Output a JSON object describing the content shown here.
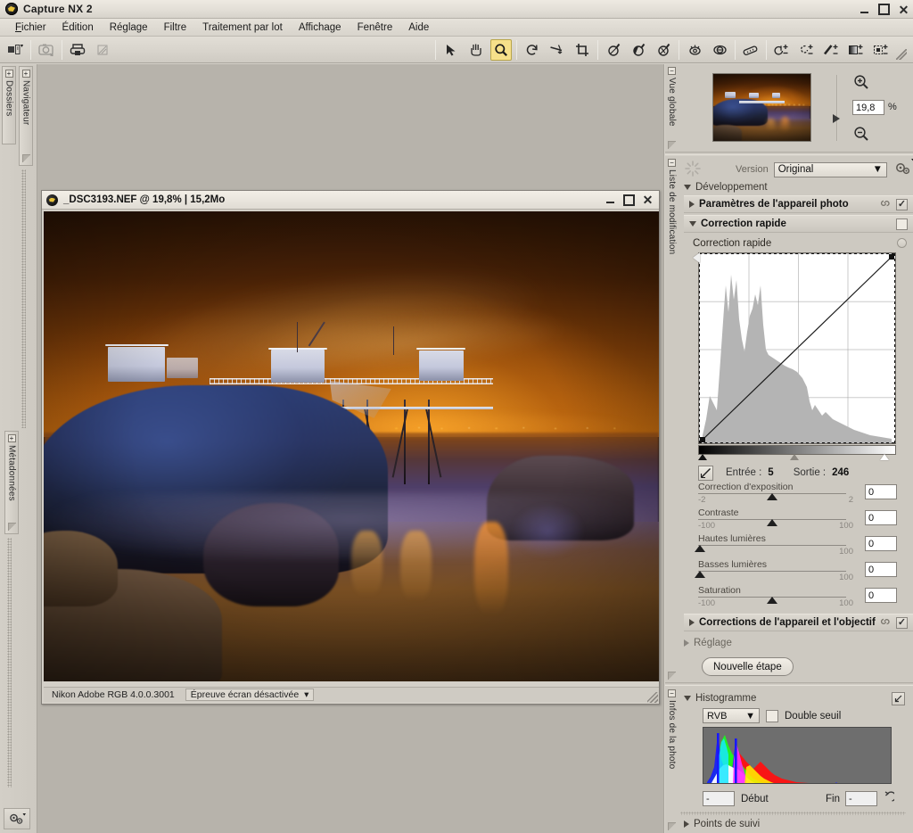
{
  "app": {
    "title": "Capture NX 2",
    "logo_icon": "nikon-nx-logo",
    "window_controls": {
      "minimize": "minimize-icon",
      "maximize": "maximize-icon",
      "close": "close-icon"
    }
  },
  "menubar": {
    "items": [
      {
        "label": "Fichier",
        "accel": "F"
      },
      {
        "label": "Édition",
        "accel": "É"
      },
      {
        "label": "Réglage",
        "accel": "g"
      },
      {
        "label": "Filtre",
        "accel": "t"
      },
      {
        "label": "Traitement par lot",
        "accel": "p"
      },
      {
        "label": "Affichage",
        "accel": "A"
      },
      {
        "label": "Fenêtre",
        "accel": "e"
      },
      {
        "label": "Aide",
        "accel": "i"
      }
    ]
  },
  "toolbar": {
    "left_group": [
      {
        "name": "open-image-browser-icon",
        "enabled": true
      },
      {
        "name": "camera-transfer-icon",
        "enabled": false
      },
      {
        "name": "print-icon",
        "enabled": true
      },
      {
        "name": "print-options-icon",
        "enabled": false
      }
    ],
    "right_group": [
      {
        "name": "direct-select-arrow-icon",
        "active": false
      },
      {
        "name": "hand-pan-icon",
        "active": false
      },
      {
        "name": "zoom-magnifier-icon",
        "active": true
      },
      {
        "name": "rotate-icon",
        "active": false
      },
      {
        "name": "straighten-icon",
        "active": false
      },
      {
        "name": "crop-icon",
        "active": false
      },
      {
        "name": "white-balance-eyedropper-icon",
        "active": false
      },
      {
        "name": "black-control-point-icon",
        "active": false
      },
      {
        "name": "color-control-point-icon",
        "active": false
      },
      {
        "name": "red-eye-icon",
        "active": false
      },
      {
        "name": "auto-retouch-brush-icon",
        "active": false
      },
      {
        "name": "measure-ruler-icon",
        "active": false
      },
      {
        "name": "selection-brush-icon",
        "active": false
      },
      {
        "name": "lasso-selection-icon",
        "active": false
      },
      {
        "name": "selection-pencil-icon",
        "active": false
      },
      {
        "name": "gradient-selection-icon",
        "active": false
      },
      {
        "name": "fill-remove-selection-icon",
        "active": false
      }
    ]
  },
  "left_dock": {
    "tabs": [
      {
        "label": "Dossiers",
        "name": "sidebar-tab-dossiers"
      },
      {
        "label": "Navigateur",
        "name": "sidebar-tab-navigateur"
      },
      {
        "label": "Métadonnées",
        "name": "sidebar-tab-metadonnees"
      }
    ],
    "settings_icon": "gears-icon"
  },
  "document_window": {
    "logo_icon": "nikon-nx-logo",
    "title": "_DSC3193.NEF @ 19,8% | 15,2Mo",
    "controls": {
      "minimize": "minimize-icon",
      "maximize": "maximize-icon",
      "close": "close-icon"
    },
    "status": {
      "color_profile": "Nikon Adobe RGB 4.0.0.3001",
      "soft_proof": "Épreuve écran désactivée"
    },
    "photo_alt": "Night coastal scene with illuminated fishing huts on stilts, blue-lit rocks and orange city lights on the horizon"
  },
  "right_dock": {
    "overview": {
      "tab_label": "Vue globale",
      "zoom_in_icon": "zoom-in-icon",
      "zoom_out_icon": "zoom-out-icon",
      "zoom_value": "19,8",
      "zoom_unit": "%"
    },
    "edit_list": {
      "tab_label": "Liste de modification",
      "sun_icon": "sun-burst-icon",
      "version_label": "Version",
      "version_value": "Original",
      "settings_icon": "gears-icon",
      "group_title": "Développement",
      "steps": [
        {
          "label": "Paramètres de l'appareil photo",
          "expanded": false,
          "link_icon": "chain-link-icon",
          "checked": true
        },
        {
          "label": "Correction rapide",
          "expanded": true,
          "checked": false
        }
      ],
      "quick_fix": {
        "sub_label": "Correction rapide",
        "reset_icon": "reset-circle-icon",
        "input_label": "Entrée :",
        "input_value": "5",
        "output_label": "Sortie :",
        "output_value": "246",
        "curve_icon": "curve-diagonal-icon",
        "sliders": [
          {
            "label": "Correction d'exposition",
            "min": "-2",
            "max": "2",
            "value": "0",
            "thumb_pct": 50
          },
          {
            "label": "Contraste",
            "min": "-100",
            "max": "100",
            "value": "0",
            "thumb_pct": 50
          },
          {
            "label": "Hautes lumières",
            "min": "",
            "max": "100",
            "value": "0",
            "thumb_pct": 3
          },
          {
            "label": "Basses lumières",
            "min": "",
            "max": "100",
            "value": "0",
            "thumb_pct": 3
          },
          {
            "label": "Saturation",
            "min": "-100",
            "max": "100",
            "value": "0",
            "thumb_pct": 50
          }
        ]
      },
      "steps_tail": [
        {
          "label": "Corrections de l'appareil et l'objectif",
          "expanded": false,
          "link_icon": "chain-link-icon",
          "checked": true
        }
      ],
      "adjust_title": "Réglage",
      "new_step_button": "Nouvelle étape"
    },
    "photo_info": {
      "tab_label": "Infos de la photo",
      "histogram": {
        "title": "Histogramme",
        "expand_icon": "expand-arrow-icon",
        "channel_value": "RVB",
        "double_threshold_label": "Double seuil",
        "double_threshold_checked": false,
        "start_label": "Début",
        "start_value": "-",
        "end_label": "Fin",
        "end_value": "-",
        "reset_icon": "undo-arrow-icon"
      },
      "watch_points_title": "Points de suivi"
    }
  },
  "chart_data": [
    {
      "type": "area",
      "name": "quick-fix-tone-curve-histogram",
      "title": "Correction rapide",
      "xlabel": "Entrée",
      "ylabel": "Sortie",
      "xlim": [
        0,
        255
      ],
      "ylim": [
        0,
        255
      ],
      "grid": true,
      "curve_points": [
        [
          5,
          0
        ],
        [
          255,
          255
        ]
      ],
      "black_point": 5,
      "white_point": 246,
      "categories": [
        0,
        8,
        16,
        24,
        32,
        40,
        48,
        56,
        64,
        72,
        80,
        88,
        96,
        104,
        112,
        120,
        128,
        136,
        144,
        152,
        160,
        168,
        176,
        184,
        192,
        200,
        208,
        216,
        224,
        232,
        240,
        248,
        255
      ],
      "values": [
        2,
        18,
        34,
        30,
        22,
        52,
        74,
        88,
        66,
        92,
        84,
        60,
        46,
        40,
        38,
        36,
        34,
        30,
        26,
        20,
        17,
        14,
        12,
        10,
        9,
        8,
        7,
        6,
        5,
        4,
        3,
        2,
        1
      ]
    },
    {
      "type": "area",
      "name": "rgb-histogram",
      "title": "Histogramme",
      "channel": "RVB",
      "xlim": [
        0,
        255
      ],
      "grid": false,
      "series": [
        {
          "name": "Rouge",
          "color": "#ff0000",
          "values": [
            1,
            3,
            6,
            10,
            16,
            22,
            26,
            30,
            36,
            44,
            58,
            50,
            42,
            36,
            30,
            34,
            38,
            34,
            30,
            26,
            22,
            18,
            14,
            11,
            9,
            7,
            5,
            4,
            3,
            2,
            2,
            1,
            1
          ]
        },
        {
          "name": "Vert",
          "color": "#00ff00",
          "values": [
            2,
            8,
            20,
            44,
            78,
            92,
            70,
            56,
            48,
            40,
            34,
            26,
            20,
            14,
            10,
            7,
            5,
            3,
            2,
            2,
            1,
            1,
            1,
            0,
            0,
            0,
            0,
            0,
            0,
            0,
            0,
            0,
            0
          ]
        },
        {
          "name": "Bleu",
          "color": "#0000ff",
          "values": [
            3,
            12,
            30,
            96,
            60,
            40,
            34,
            30,
            36,
            88,
            42,
            22,
            14,
            9,
            6,
            4,
            3,
            2,
            1,
            1,
            1,
            0,
            0,
            0,
            0,
            0,
            0,
            0,
            0,
            0,
            0,
            0,
            0
          ]
        }
      ],
      "categories": [
        0,
        8,
        16,
        24,
        32,
        40,
        48,
        56,
        64,
        72,
        80,
        88,
        96,
        104,
        112,
        120,
        128,
        136,
        144,
        152,
        160,
        168,
        176,
        184,
        192,
        200,
        208,
        216,
        224,
        232,
        240,
        248,
        255
      ]
    }
  ]
}
